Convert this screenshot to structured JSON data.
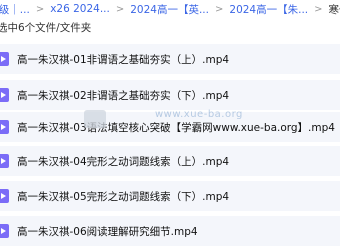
{
  "breadcrumb": {
    "items": [
      "-级｜...",
      "x26 2024...",
      "2024高一【英...",
      "2024高一【朱...",
      "寒假班-朱汉祺英..."
    ],
    "separator": ">"
  },
  "status": {
    "selection_text": "选中6个文件/文件夹"
  },
  "files": [
    {
      "name": "高一朱汉祺-01非谓语之基础夯实（上）.mp4"
    },
    {
      "name": "高一朱汉祺-02非谓语之基础夯实（下）.mp4"
    },
    {
      "name": "高一朱汉祺-03语法填空核心突破【学霸网www.xue-ba.org】.mp4"
    },
    {
      "name": "高一朱汉祺-04完形之动词题线索（上）.mp4"
    },
    {
      "name": "高一朱汉祺-05完形之动词题线索（下）.mp4"
    },
    {
      "name": "高一朱汉祺-06阅读理解研究细节.mp4"
    }
  ],
  "watermark": {
    "url": "www.xue-ba.org"
  },
  "colors": {
    "link": "#3b66e6",
    "row_selected": "#f4f6fb",
    "file_icon": "#7b6cf7"
  },
  "icons": {
    "file": "video-file-icon"
  }
}
